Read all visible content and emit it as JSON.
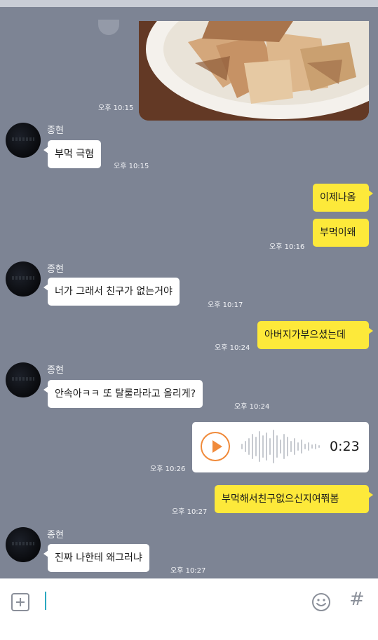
{
  "messages": {
    "photo_time": "오후 10:15",
    "m1": {
      "name": "종현",
      "text": "부먹 극혐",
      "time": "오후 10:15"
    },
    "m2": {
      "text": "이제나옴"
    },
    "m3": {
      "text": "부먹이왜",
      "time": "오후 10:16"
    },
    "m4": {
      "name": "종현",
      "text": "너가 그래서 친구가 없는거야",
      "time": "오후 10:17"
    },
    "m5": {
      "text": "아버지가부으셨는데",
      "time": "오후 10:24"
    },
    "m6": {
      "name": "종현",
      "text": "안속아ㅋㅋ 또 탈룰라라고 올리게?",
      "time": "오후 10:24"
    },
    "m7": {
      "duration": "0:23",
      "time": "오후 10:26"
    },
    "m8": {
      "text": "부먹해서친구없으신지여쭤봄",
      "time": "오후 10:27"
    },
    "m9": {
      "name": "종현",
      "text": "진짜 나한테 왜그러냐",
      "time": "오후 10:27"
    }
  },
  "input": {
    "value": ""
  },
  "icons": {
    "attach": "plus-square-icon",
    "emoji": "smiley-icon",
    "hashtag": "hash-icon",
    "play": "play-icon"
  },
  "colors": {
    "background": "#7d8494",
    "outgoing_bubble": "#fde93a",
    "incoming_bubble": "#ffffff",
    "voice_accent": "#f08a3a"
  }
}
